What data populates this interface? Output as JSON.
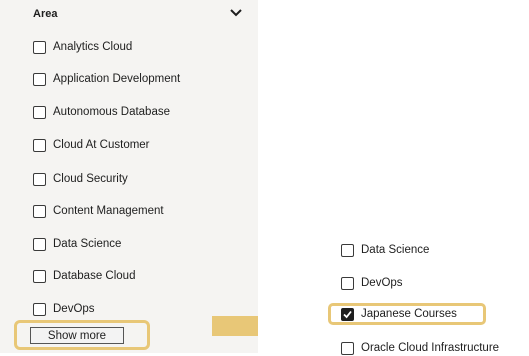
{
  "filter": {
    "title": "Area",
    "left_items": [
      {
        "label": "Analytics Cloud",
        "checked": false
      },
      {
        "label": "Application Development",
        "checked": false
      },
      {
        "label": "Autonomous Database",
        "checked": false
      },
      {
        "label": "Cloud At Customer",
        "checked": false
      },
      {
        "label": "Cloud Security",
        "checked": false
      },
      {
        "label": "Content Management",
        "checked": false
      },
      {
        "label": "Data Science",
        "checked": false
      },
      {
        "label": "Database Cloud",
        "checked": false
      },
      {
        "label": "DevOps",
        "checked": false
      }
    ],
    "show_more_label": "Show more"
  },
  "expanded": {
    "items": [
      {
        "label": "Data Science",
        "checked": false
      },
      {
        "label": "DevOps",
        "checked": false
      },
      {
        "label": "Japanese Courses",
        "checked": true
      },
      {
        "label": "Oracle Cloud Infrastructure",
        "checked": false
      }
    ]
  },
  "colors": {
    "highlight": "#e8c777",
    "arrow": "#e8c777",
    "panel_bg": "#f5f4f2"
  }
}
